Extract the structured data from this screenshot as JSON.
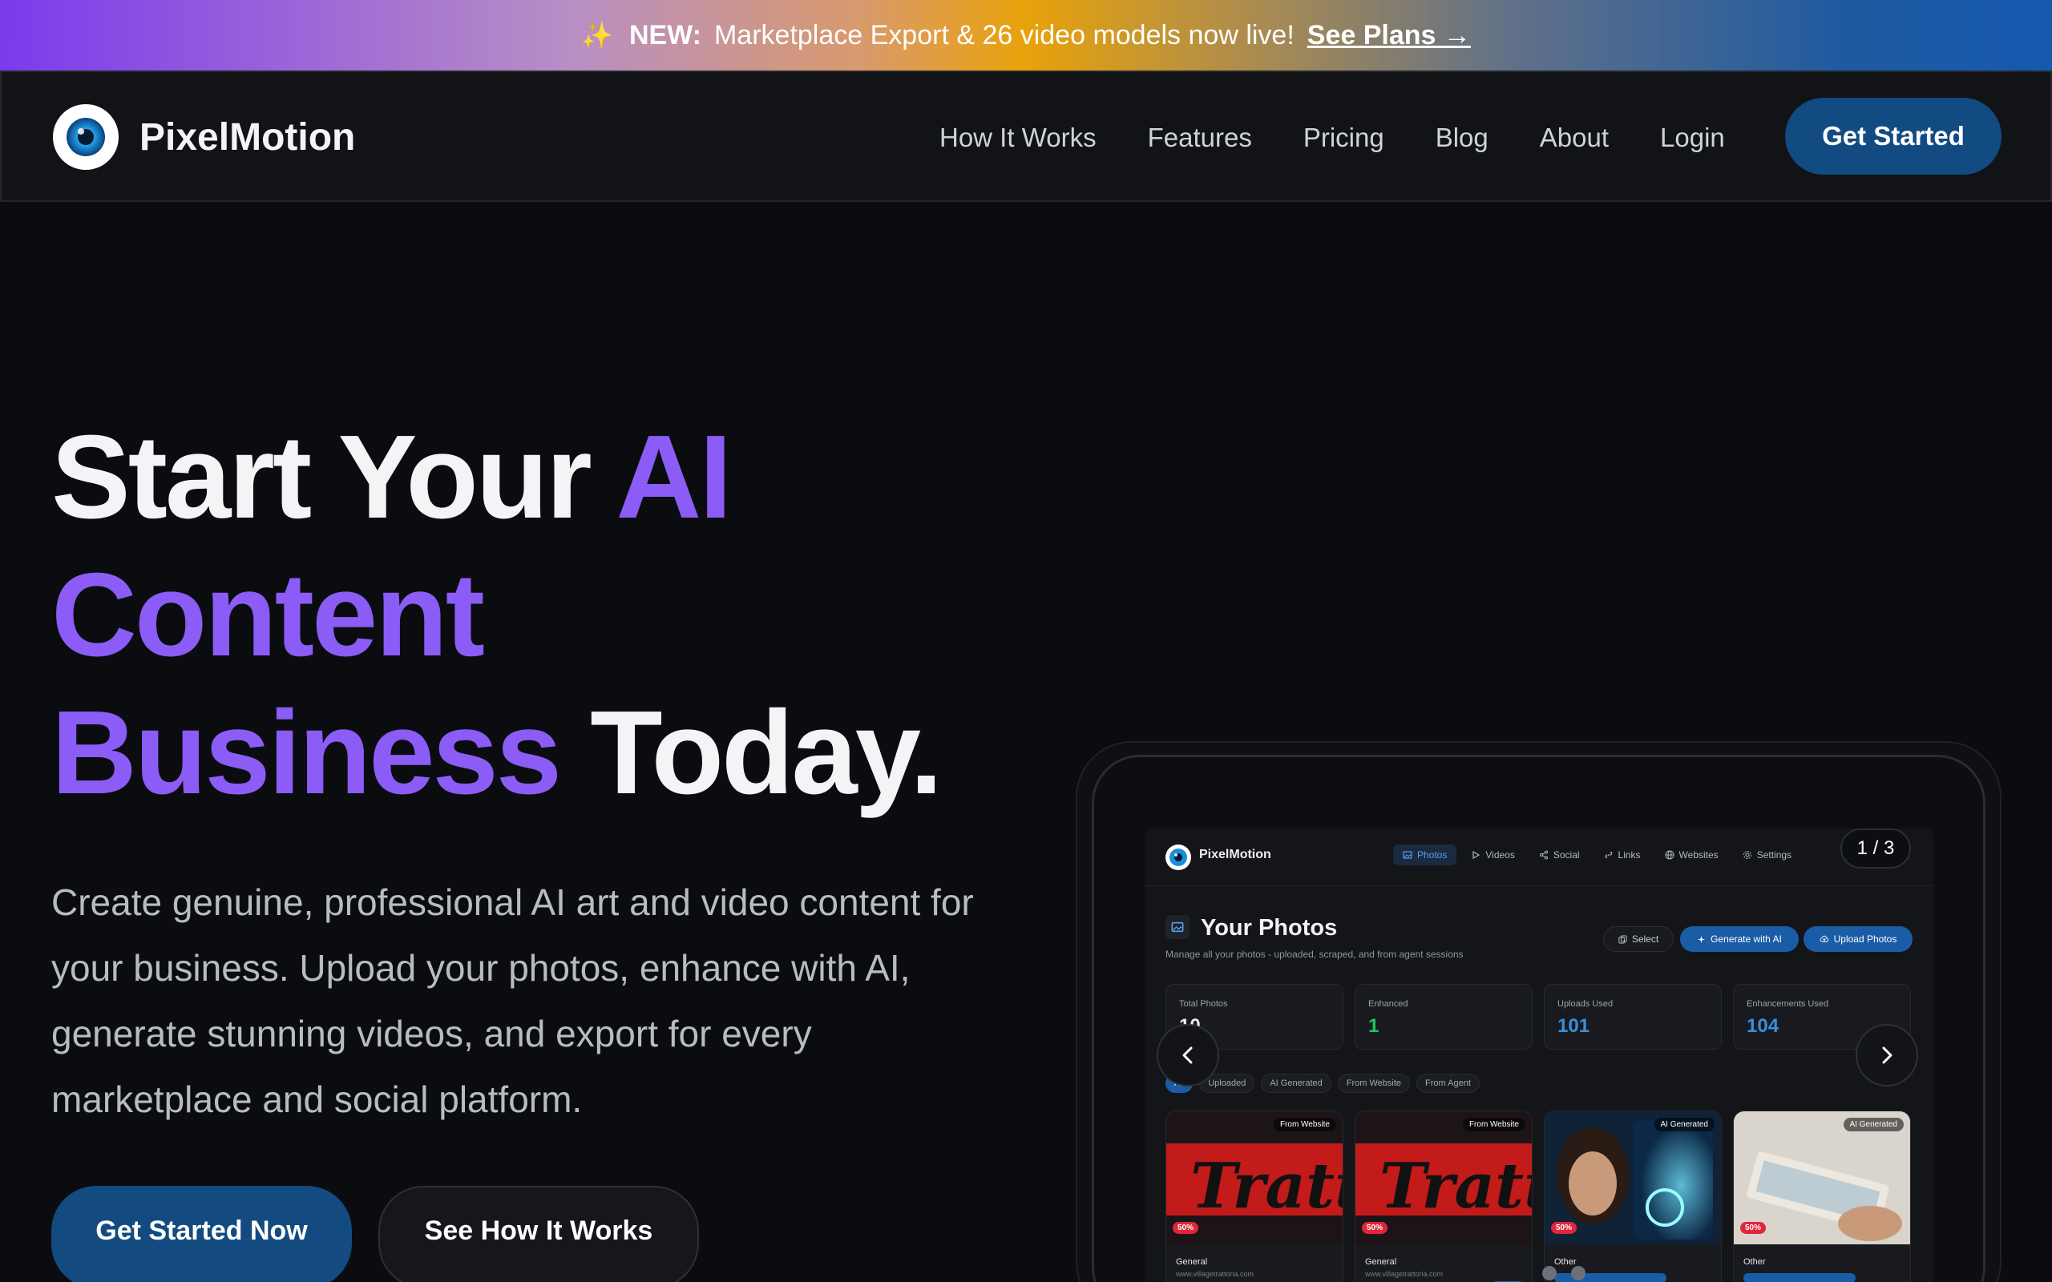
{
  "announcement": {
    "sparkle": "✨",
    "badge": "NEW:",
    "message": "Marketplace Export & 26 video models now live!",
    "link": "See Plans →"
  },
  "nav": {
    "brand": "PixelMotion",
    "links": [
      "How It Works",
      "Features",
      "Pricing",
      "Blog",
      "About",
      "Login"
    ],
    "cta": "Get Started"
  },
  "hero": {
    "title_1": "Start Your ",
    "title_2": "AI Content Business",
    "title_3": " Today.",
    "subtitle": "Create genuine, professional AI art and video content for your business. Upload your photos, enhance with AI, generate stunning videos, and export for every marketplace and social platform.",
    "primary_button": "Get Started Now",
    "secondary_button": "See How It Works"
  },
  "mockup": {
    "counter": "1 / 3",
    "brand": "PixelMotion",
    "tabs": [
      "Photos",
      "Videos",
      "Social",
      "Links",
      "Websites",
      "Settings"
    ],
    "title": "Your Photos",
    "description": "Manage all your photos - uploaded, scraped, and from agent sessions",
    "buttons": {
      "select": "Select",
      "generate": "Generate with AI",
      "upload": "Upload Photos"
    },
    "stats": [
      {
        "label": "Total Photos",
        "value": "10"
      },
      {
        "label": "Enhanced",
        "value": "1"
      },
      {
        "label": "Uploads Used",
        "value": "101"
      },
      {
        "label": "Enhancements Used",
        "value": "104"
      }
    ],
    "filters": [
      "All",
      "Uploaded",
      "AI Generated",
      "From Website",
      "From Agent"
    ],
    "cards": [
      {
        "source": "From Website",
        "badge": "50%",
        "category": "General",
        "site": "www.villagetrattoria.com",
        "thumb_text": "Tratt"
      },
      {
        "source": "From Website",
        "badge": "50%",
        "category": "General",
        "site": "www.villagetrattoria.com",
        "thumb_text": "Tratt"
      },
      {
        "source": "AI Generated",
        "badge": "50%",
        "category": "Other",
        "site": ""
      },
      {
        "source": "AI Generated",
        "badge": "50%",
        "category": "Other",
        "site": ""
      }
    ]
  },
  "colors": {
    "accent_purple": "#8b5cf6",
    "primary_blue": "#134b80",
    "stat_green": "#22c55e",
    "stat_blue": "#3b8fdc"
  }
}
